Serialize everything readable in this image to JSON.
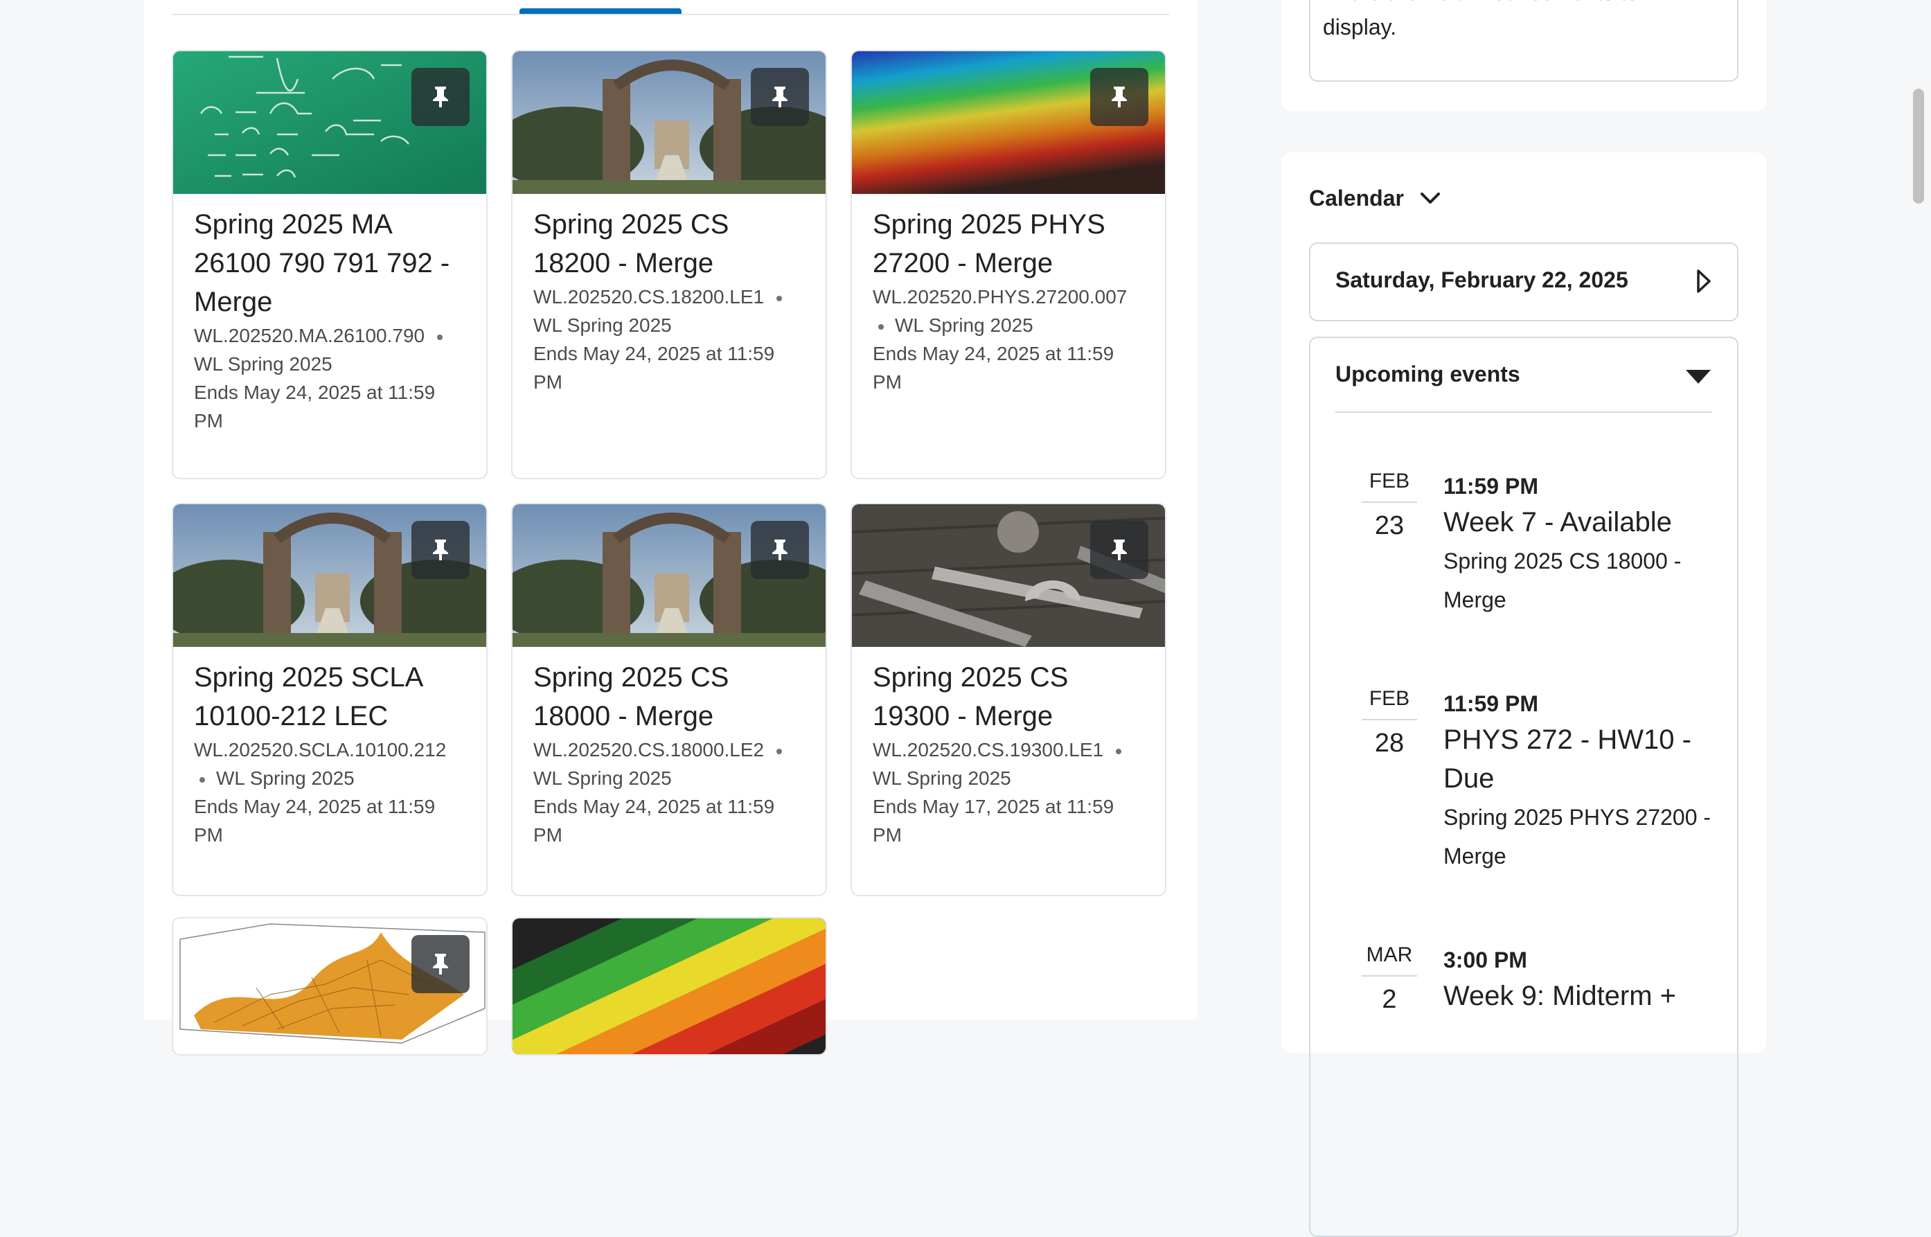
{
  "courses": [
    {
      "title": "Spring 2025 MA 26100 790 791 792 - Merge",
      "code": "WL.202520.MA.26100.790",
      "semester": "WL Spring 2025",
      "ends": "Ends May 24, 2025 at 11:59 PM",
      "image": "chalkboard-math"
    },
    {
      "title": "Spring 2025 CS 18200 - Merge",
      "code": "WL.202520.CS.18200.LE1",
      "semester": "WL Spring 2025",
      "ends": "Ends May 24, 2025 at 11:59 PM",
      "image": "campus-gateway"
    },
    {
      "title": "Spring 2025 PHYS 27200 - Merge",
      "code": "WL.202520.PHYS.27200.007",
      "semester": "WL Spring 2025",
      "ends": "Ends May 24, 2025 at 11:59 PM",
      "image": "rainbow-texture"
    },
    {
      "title": "Spring 2025 SCLA 10100-212 LEC",
      "code": "WL.202520.SCLA.10100.212",
      "semester": "WL Spring 2025",
      "ends": "Ends May 24, 2025 at 11:59 PM",
      "image": "campus-gateway"
    },
    {
      "title": "Spring 2025 CS 18000 - Merge",
      "code": "WL.202520.CS.18000.LE2",
      "semester": "WL Spring 2025",
      "ends": "Ends May 24, 2025 at 11:59 PM",
      "image": "campus-gateway"
    },
    {
      "title": "Spring 2025 CS 19300 - Merge",
      "code": "WL.202520.CS.19300.LE1",
      "semester": "WL Spring 2025",
      "ends": "Ends May 17, 2025 at 11:59 PM",
      "image": "tools-wrenches"
    },
    {
      "title": "",
      "code": "",
      "semester": "",
      "ends": "",
      "image": "3d-surface-plot"
    },
    {
      "title": "",
      "code": "",
      "semester": "",
      "ends": "",
      "image": "colored-pencils"
    }
  ],
  "announcements": {
    "empty_text": "There are no announcements to display."
  },
  "calendar": {
    "title": "Calendar",
    "date": "Saturday, February 22, 2025",
    "upcoming_title": "Upcoming events",
    "events": [
      {
        "month": "FEB",
        "day": "23",
        "time": "11:59 PM",
        "name": "Week 7 - Available",
        "course": "Spring 2025 CS 18000 - Merge"
      },
      {
        "month": "FEB",
        "day": "28",
        "time": "11:59 PM",
        "name": "PHYS 272 - HW10 - Due",
        "course": "Spring 2025 PHYS 27200 - Merge"
      },
      {
        "month": "MAR",
        "day": "2",
        "time": "3:00 PM",
        "name": "Week 9: Midterm +",
        "course": ""
      }
    ]
  },
  "icons": {
    "pin": "pin-icon",
    "calendar_toggle": "chevron-down-icon",
    "next_day": "triangle-right-icon",
    "events_toggle": "caret-down-icon"
  },
  "colors": {
    "accent": "#006fbf",
    "border": "#d3d9e3",
    "text": "#202122"
  }
}
